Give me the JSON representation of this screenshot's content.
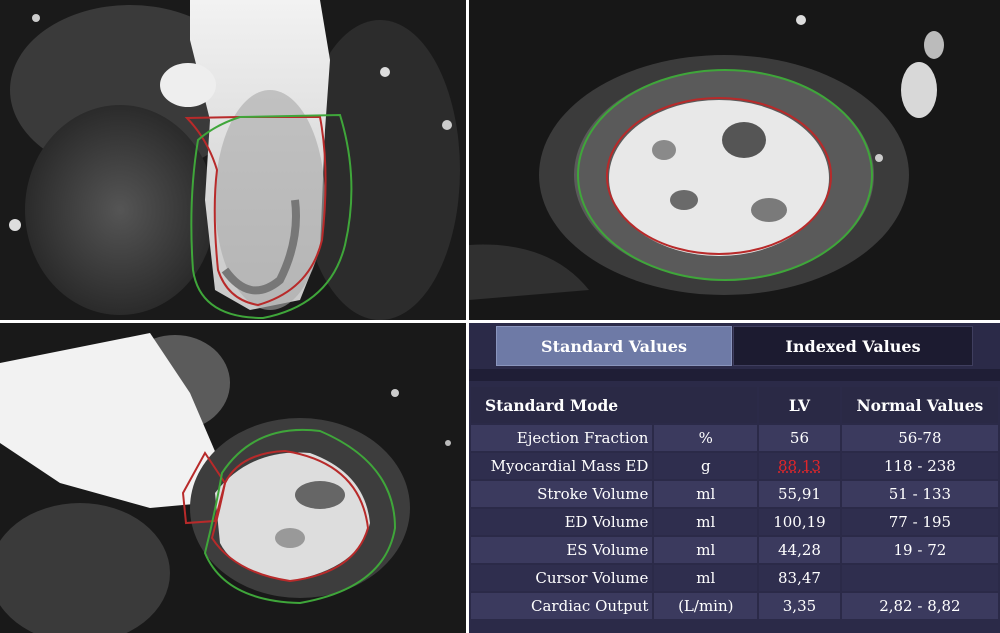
{
  "colors": {
    "endocardial_contour": "#b82a2a",
    "epicardial_contour": "#3fa63a",
    "panel_background": "#2b2a48",
    "active_tab": "#6e7aa6",
    "inactive_tab": "#1c1b30",
    "abnormal_value": "#e0262a"
  },
  "tabs": [
    {
      "label": "Standard Values",
      "active": true
    },
    {
      "label": "Indexed Values",
      "active": false
    }
  ],
  "table": {
    "headers": {
      "mode": "Standard Mode",
      "lv": "LV",
      "normal": "Normal Values"
    },
    "rows": [
      {
        "label": "Ejection Fraction",
        "unit": "%",
        "lv": "56",
        "normal": "56-78",
        "abnormal": false
      },
      {
        "label": "Myocardial Mass ED",
        "unit": "g",
        "lv": "88,13",
        "normal": "118 - 238",
        "abnormal": true
      },
      {
        "label": "Stroke Volume",
        "unit": "ml",
        "lv": "55,91",
        "normal": "51 - 133",
        "abnormal": false
      },
      {
        "label": "ED Volume",
        "unit": "ml",
        "lv": "100,19",
        "normal": "77 - 195",
        "abnormal": false
      },
      {
        "label": "ES Volume",
        "unit": "ml",
        "lv": "44,28",
        "normal": "19 - 72",
        "abnormal": false
      },
      {
        "label": "Cursor Volume",
        "unit": "ml",
        "lv": "83,47",
        "normal": "",
        "abnormal": false
      },
      {
        "label": "Cardiac Output",
        "unit": "(L/min)",
        "lv": "3,35",
        "normal": "2,82 - 8,82",
        "abnormal": false
      }
    ]
  }
}
